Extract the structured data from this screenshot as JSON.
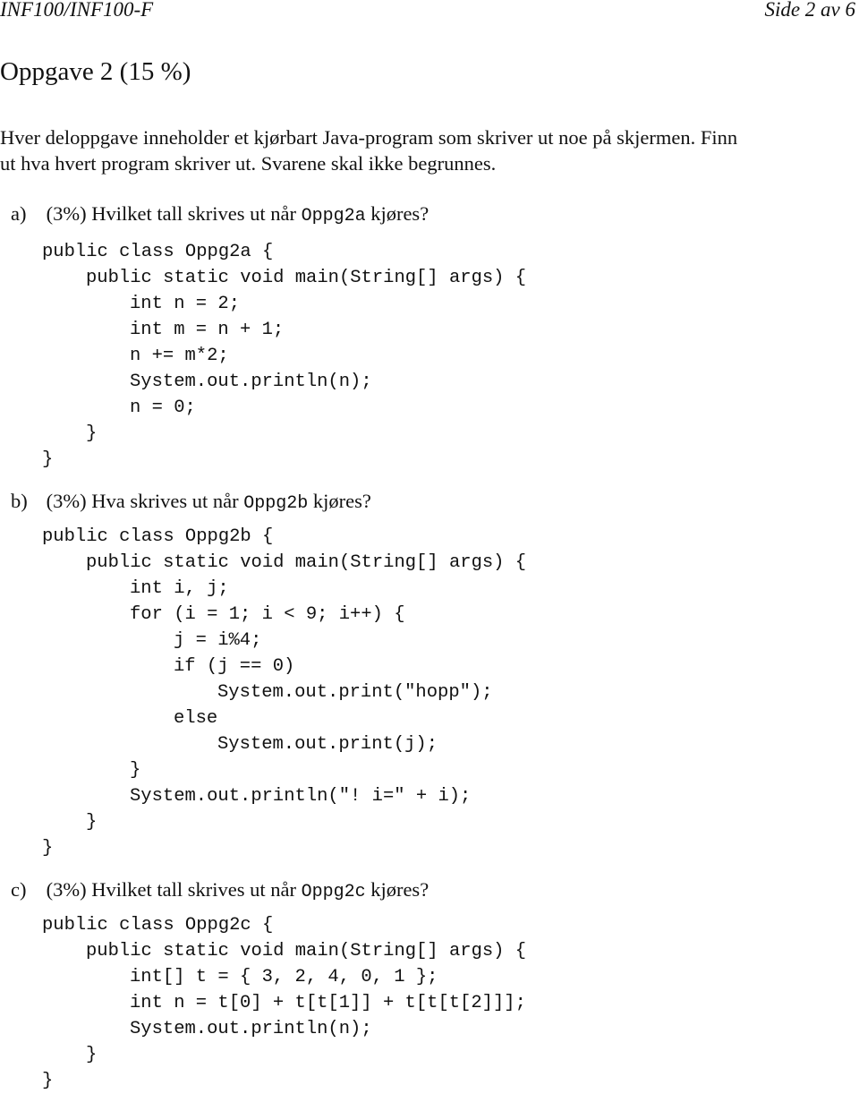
{
  "header": {
    "course": "INF100/INF100-F",
    "page": "Side 2 av 6"
  },
  "title": "Oppgave 2 (15 %)",
  "intro": [
    "Hver deloppgave inneholder et kjørbart Java-program som skriver ut noe på skjermen. Finn",
    "ut hva hvert program skriver ut. Svarene skal ikke begrunnes."
  ],
  "tasks": [
    {
      "label": "a)",
      "weight": "(3%)",
      "question_pre": "Hvilket tall skrives ut når",
      "class_name": "Oppg2a",
      "question_post": "kjøres?",
      "code": [
        {
          "indent": 0,
          "text": "public class Oppg2a {"
        },
        {
          "indent": 1,
          "text": "public static void main(String[] args) {"
        },
        {
          "indent": 2,
          "text": "int n = 2;"
        },
        {
          "indent": 2,
          "text": "int m = n + 1;"
        },
        {
          "indent": 2,
          "text": "n += m*2;"
        },
        {
          "indent": 2,
          "text": "System.out.println(n);"
        },
        {
          "indent": 2,
          "text": "n = 0;"
        },
        {
          "indent": 1,
          "text": "}"
        },
        {
          "indent": 0,
          "text": "}"
        }
      ]
    },
    {
      "label": "b)",
      "weight": "(3%)",
      "question_pre": "Hva skrives ut når",
      "class_name": "Oppg2b",
      "question_post": "kjøres?",
      "code": [
        {
          "indent": 0,
          "text": "public class Oppg2b {"
        },
        {
          "indent": 1,
          "text": "public static void main(String[] args) {"
        },
        {
          "indent": 2,
          "text": "int i, j;"
        },
        {
          "indent": 2,
          "text": "for (i = 1; i < 9; i++) {"
        },
        {
          "indent": 3,
          "text": "j = i%4;"
        },
        {
          "indent": 3,
          "text": "if (j == 0)"
        },
        {
          "indent": 4,
          "text": "System.out.print(\"hopp\");"
        },
        {
          "indent": 3,
          "text": "else"
        },
        {
          "indent": 4,
          "text": "System.out.print(j);"
        },
        {
          "indent": 2,
          "text": "}"
        },
        {
          "indent": 2,
          "text": "System.out.println(\"! i=\" + i);"
        },
        {
          "indent": 1,
          "text": "}"
        },
        {
          "indent": 0,
          "text": "}"
        }
      ]
    },
    {
      "label": "c)",
      "weight": "(3%)",
      "question_pre": "Hvilket tall skrives ut når",
      "class_name": "Oppg2c",
      "question_post": "kjøres?",
      "code": [
        {
          "indent": 0,
          "text": "public class Oppg2c {"
        },
        {
          "indent": 1,
          "text": "public static void main(String[] args) {"
        },
        {
          "indent": 2,
          "text": "int[] t = { 3, 2, 4, 0, 1 };"
        },
        {
          "indent": 2,
          "text": "int n = t[0] + t[t[1]] + t[t[t[2]]];"
        },
        {
          "indent": 2,
          "text": "System.out.println(n);"
        },
        {
          "indent": 1,
          "text": "}"
        },
        {
          "indent": 0,
          "text": "}"
        }
      ]
    }
  ]
}
